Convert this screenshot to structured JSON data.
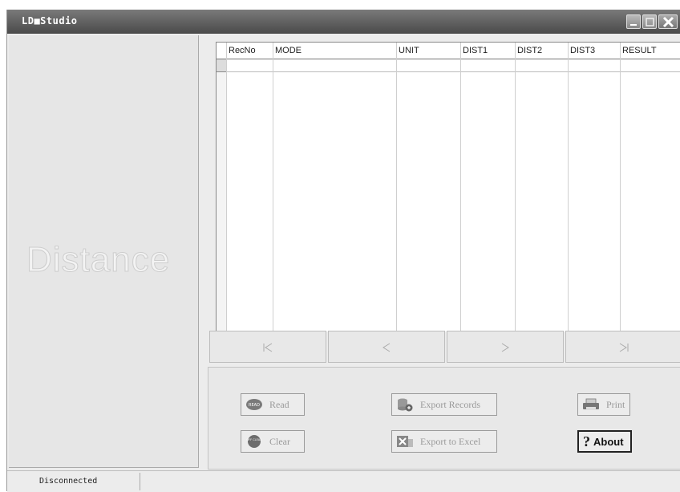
{
  "window": {
    "title": "LD■Studio"
  },
  "left_panel": {
    "watermark": "Distance"
  },
  "grid": {
    "columns": [
      "RecNo",
      "MODE",
      "UNIT",
      "DIST1",
      "DIST2",
      "DIST3",
      "RESULT"
    ],
    "rows": []
  },
  "navigator": {
    "first": "|◁",
    "prev": "◁",
    "next": "▷",
    "last": "▷|"
  },
  "buttons": {
    "read": "Read",
    "clear": "Clear",
    "export_records": "Export Records",
    "export_excel": "Export to Excel",
    "print": "Print",
    "about": "About",
    "read_badge": "READ",
    "clear_badge": "OFF CLEAR"
  },
  "status": {
    "connection": "Disconnected"
  }
}
